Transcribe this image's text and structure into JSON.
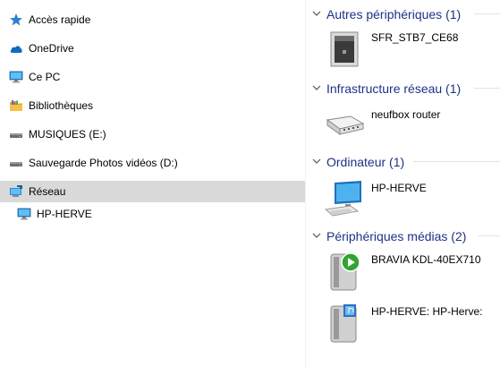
{
  "nav": {
    "items": [
      {
        "label": "Accès rapide",
        "icon": "star-icon"
      },
      {
        "label": "OneDrive",
        "icon": "cloud-icon"
      },
      {
        "label": "Ce PC",
        "icon": "computer-icon"
      },
      {
        "label": "Bibliothèques",
        "icon": "library-icon"
      },
      {
        "label": "MUSIQUES (E:)",
        "icon": "drive-icon"
      },
      {
        "label": "Sauvegarde Photos vidéos (D:)",
        "icon": "drive-icon"
      },
      {
        "label": "Réseau",
        "icon": "network-icon",
        "selected": true
      },
      {
        "label": "HP-HERVE",
        "icon": "computer-icon"
      }
    ]
  },
  "groups": [
    {
      "title": "Autres périphériques (1)",
      "devices": [
        {
          "label": "SFR_STB7_CE68",
          "icon": "set-top-box-icon"
        }
      ]
    },
    {
      "title": "Infrastructure réseau (1)",
      "devices": [
        {
          "label": "neufbox router",
          "icon": "router-icon"
        }
      ]
    },
    {
      "title": "Ordinateur (1)",
      "devices": [
        {
          "label": "HP-HERVE",
          "icon": "desktop-computer-icon"
        }
      ]
    },
    {
      "title": "Périphériques médias (2)",
      "devices": [
        {
          "label": "BRAVIA KDL-40EX710",
          "icon": "media-renderer-icon"
        },
        {
          "label": "HP-HERVE: HP-Herve:",
          "icon": "media-server-icon"
        }
      ]
    }
  ],
  "colors": {
    "accent": "#1e3287",
    "selected": "#d9d9d9"
  }
}
